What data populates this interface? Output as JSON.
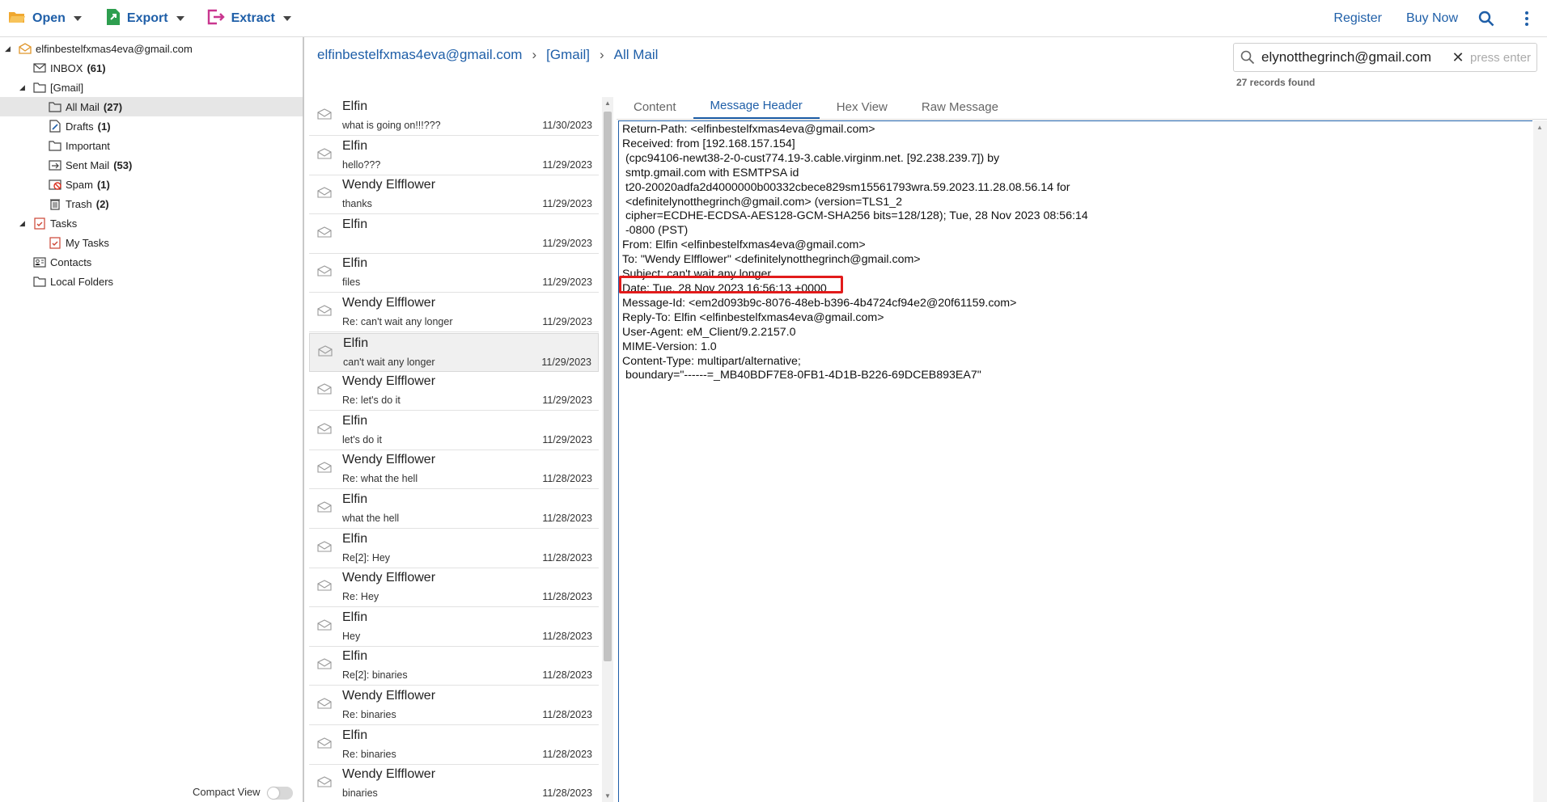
{
  "toolbar": {
    "open_label": "Open",
    "export_label": "Export",
    "extract_label": "Extract",
    "register_label": "Register",
    "buynow_label": "Buy Now"
  },
  "sidebar": {
    "account": "elfinbestelfxmas4eva@gmail.com",
    "inbox": {
      "label": "INBOX",
      "count": "(61)"
    },
    "gmail": "[Gmail]",
    "allmail": {
      "label": "All Mail",
      "count": "(27)"
    },
    "drafts": {
      "label": "Drafts",
      "count": "(1)"
    },
    "important": "Important",
    "sent": {
      "label": "Sent Mail",
      "count": "(53)"
    },
    "spam": {
      "label": "Spam",
      "count": "(1)"
    },
    "trash": {
      "label": "Trash",
      "count": "(2)"
    },
    "tasks": "Tasks",
    "mytasks": "My Tasks",
    "contacts": "Contacts",
    "localfolders": "Local Folders",
    "compact_view": "Compact View"
  },
  "breadcrumb": {
    "account": "elfinbestelfxmas4eva@gmail.com",
    "gmail": "[Gmail]",
    "folder": "All Mail"
  },
  "search": {
    "value": "elynotthegrinch@gmail.com",
    "placeholder": "press enter",
    "records": "27 records found"
  },
  "messages": [
    {
      "sender": "Elfin",
      "subject": "what is going on!!!???",
      "date": "11/30/2023"
    },
    {
      "sender": "Elfin",
      "subject": "hello???",
      "date": "11/29/2023"
    },
    {
      "sender": "Wendy Elfflower",
      "subject": "thanks",
      "date": "11/29/2023"
    },
    {
      "sender": "Elfin",
      "subject": "",
      "date": "11/29/2023"
    },
    {
      "sender": "Elfin",
      "subject": "files",
      "date": "11/29/2023"
    },
    {
      "sender": "Wendy Elfflower",
      "subject": "Re: can't wait any longer",
      "date": "11/29/2023"
    },
    {
      "sender": "Elfin",
      "subject": "can't wait any longer",
      "date": "11/29/2023"
    },
    {
      "sender": "Wendy Elfflower",
      "subject": "Re: let's do it",
      "date": "11/29/2023"
    },
    {
      "sender": "Elfin",
      "subject": "let's do it",
      "date": "11/29/2023"
    },
    {
      "sender": "Wendy Elfflower",
      "subject": "Re: what the hell",
      "date": "11/28/2023"
    },
    {
      "sender": "Elfin",
      "subject": "what the hell",
      "date": "11/28/2023"
    },
    {
      "sender": "Elfin",
      "subject": "Re[2]: Hey",
      "date": "11/28/2023"
    },
    {
      "sender": "Wendy Elfflower",
      "subject": "Re: Hey",
      "date": "11/28/2023"
    },
    {
      "sender": "Elfin",
      "subject": "Hey",
      "date": "11/28/2023"
    },
    {
      "sender": "Elfin",
      "subject": "Re[2]: binaries",
      "date": "11/28/2023"
    },
    {
      "sender": "Wendy Elfflower",
      "subject": "Re: binaries",
      "date": "11/28/2023"
    },
    {
      "sender": "Elfin",
      "subject": "Re: binaries",
      "date": "11/28/2023"
    },
    {
      "sender": "Wendy Elfflower",
      "subject": "binaries",
      "date": "11/28/2023"
    }
  ],
  "selected_message_index": 6,
  "tabs": [
    "Content",
    "Message Header",
    "Hex View",
    "Raw Message"
  ],
  "active_tab": "Message Header",
  "header_text": "Return-Path: <elfinbestelfxmas4eva@gmail.com>\nReceived: from [192.168.157.154]\n (cpc94106-newt38-2-0-cust774.19-3.cable.virginm.net. [92.238.239.7]) by\n smtp.gmail.com with ESMTPSA id\n t20-20020adfa2d4000000b00332cbece829sm15561793wra.59.2023.11.28.08.56.14 for\n <definitelynotthegrinch@gmail.com> (version=TLS1_2\n cipher=ECDHE-ECDSA-AES128-GCM-SHA256 bits=128/128); Tue, 28 Nov 2023 08:56:14\n -0800 (PST)\nFrom: Elfin <elfinbestelfxmas4eva@gmail.com>\nTo: \"Wendy Elfflower\" <definitelynotthegrinch@gmail.com>\nSubject: can't wait any longer\nDate: Tue, 28 Nov 2023 16:56:13 +0000\nMessage-Id: <em2d093b9c-8076-48eb-b396-4b4724cf94e2@20f61159.com>\nReply-To: Elfin <elfinbestelfxmas4eva@gmail.com>\nUser-Agent: eM_Client/9.2.2157.0\nMIME-Version: 1.0\nContent-Type: multipart/alternative;\n boundary=\"------=_MB40BDF7E8-0FB1-4D1B-B226-69DCEB893EA7\"",
  "colors": {
    "accent": "#1f5fa8",
    "highlight": "#e21b1b"
  }
}
